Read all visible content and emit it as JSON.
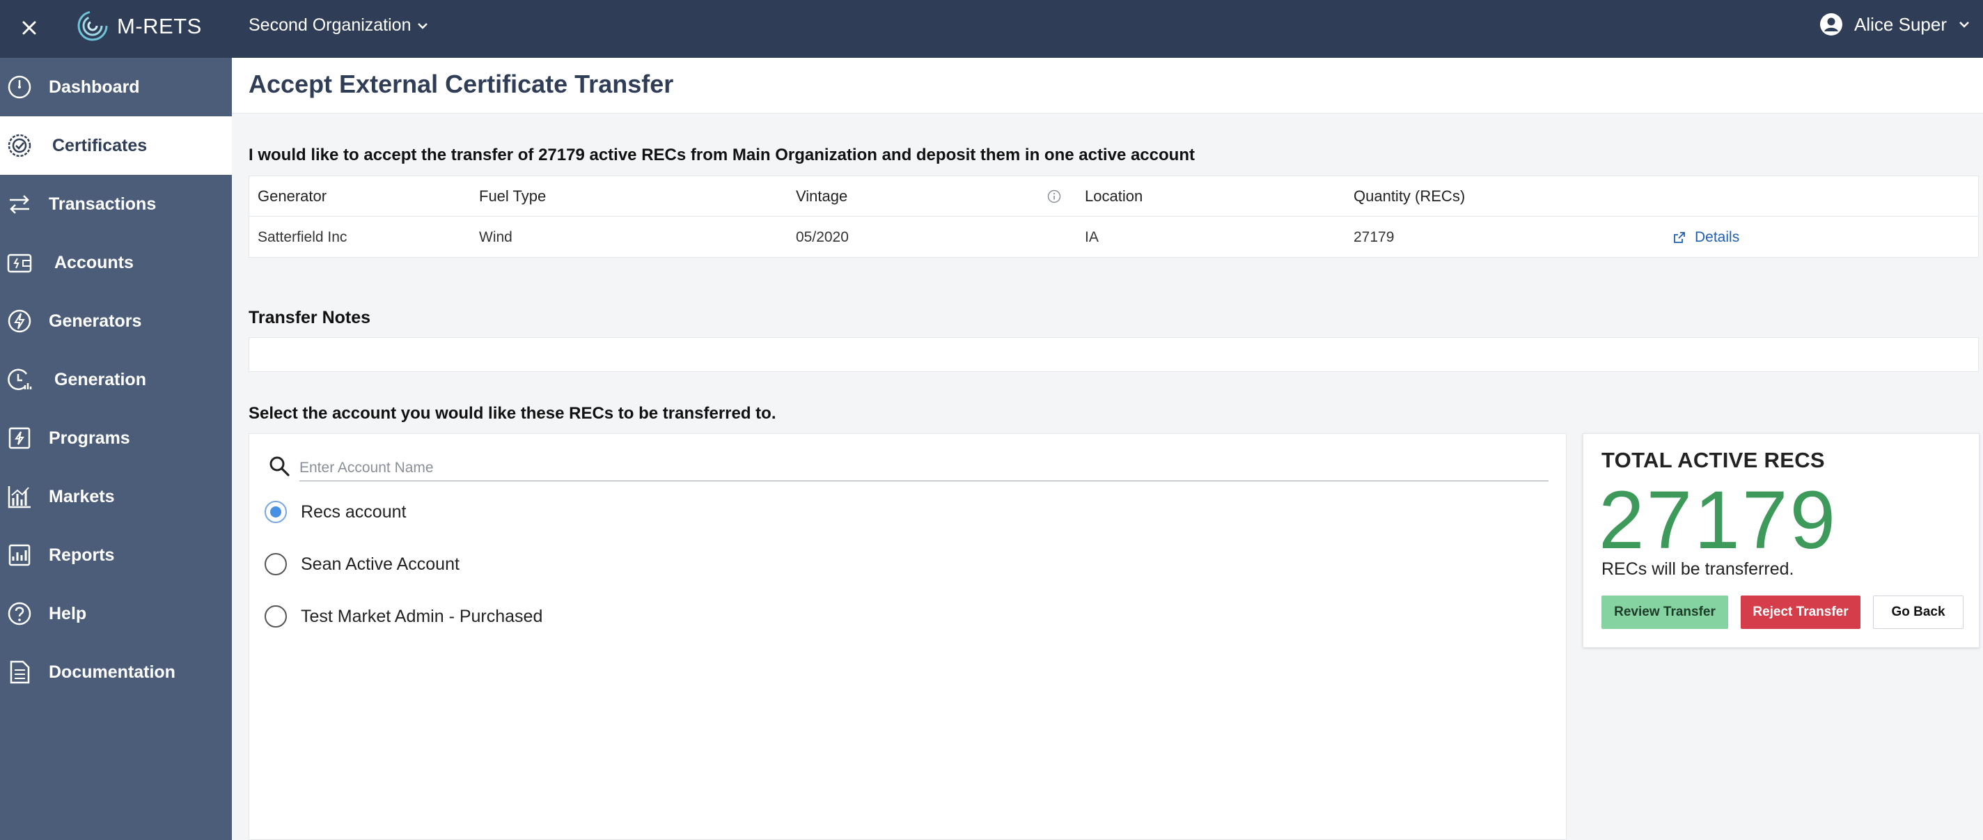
{
  "app": {
    "brand": "M-RETS",
    "organization": "Second Organization",
    "user": "Alice Super"
  },
  "sidebar": {
    "items": [
      {
        "label": "Dashboard",
        "icon": "dashboard-icon"
      },
      {
        "label": "Certificates",
        "icon": "certificate-icon",
        "active": true
      },
      {
        "label": "Transactions",
        "icon": "transactions-icon"
      },
      {
        "label": "Accounts",
        "icon": "wallet-icon"
      },
      {
        "label": "Generators",
        "icon": "bolt-icon"
      },
      {
        "label": "Generation",
        "icon": "clock-chart-icon"
      },
      {
        "label": "Programs",
        "icon": "programs-icon"
      },
      {
        "label": "Markets",
        "icon": "bar-chart-icon"
      },
      {
        "label": "Reports",
        "icon": "report-icon"
      },
      {
        "label": "Help",
        "icon": "help-icon"
      },
      {
        "label": "Documentation",
        "icon": "document-icon"
      }
    ]
  },
  "page": {
    "title": "Accept External Certificate Transfer",
    "intro": "I would like to accept the transfer of 27179 active RECs from Main Organization and deposit them in one active account"
  },
  "table": {
    "headers": [
      "Generator",
      "Fuel Type",
      "Vintage",
      "Location",
      "Quantity (RECs)"
    ],
    "row": {
      "generator": "Satterfield Inc",
      "fuel_type": "Wind",
      "vintage": "05/2020",
      "location": "IA",
      "quantity": "27179",
      "details_label": "Details"
    }
  },
  "notes": {
    "label": "Transfer Notes",
    "value": ""
  },
  "account_select": {
    "label": "Select the account you would like these RECs to be transferred to.",
    "search_placeholder": "Enter Account Name",
    "options": [
      {
        "label": "Recs account",
        "selected": true
      },
      {
        "label": "Sean Active Account",
        "selected": false
      },
      {
        "label": "Test Market Admin - Purchased",
        "selected": false
      }
    ]
  },
  "summary": {
    "title": "TOTAL ACTIVE RECS",
    "count": "27179",
    "subtitle": "RECs will be transferred.",
    "review_label": "Review Transfer",
    "reject_label": "Reject Transfer",
    "back_label": "Go Back"
  },
  "colors": {
    "topbar": "#2f3e56",
    "sidebar": "#4b5d79",
    "accent_green": "#3e9a5a",
    "review_button": "#84d3a1",
    "reject_button": "#d63d4a",
    "link": "#1d5fb4"
  }
}
